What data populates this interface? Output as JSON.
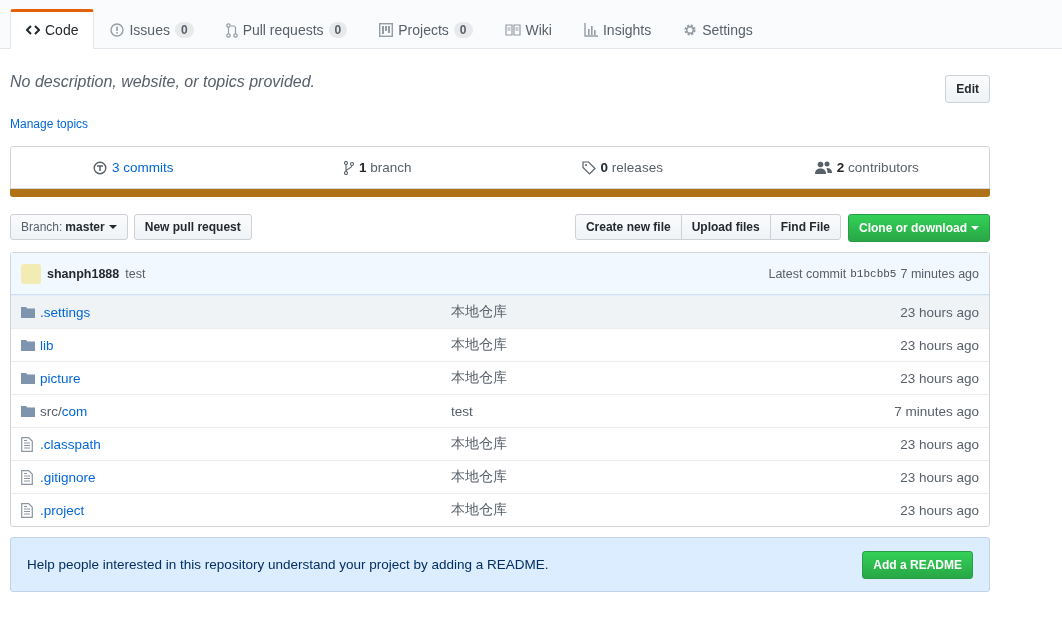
{
  "tabs": [
    {
      "kind": "code",
      "label": "Code",
      "selected": true
    },
    {
      "kind": "issues",
      "label": "Issues",
      "count": "0",
      "selected": false
    },
    {
      "kind": "pulls",
      "label": "Pull requests",
      "count": "0",
      "selected": false
    },
    {
      "kind": "projects",
      "label": "Projects",
      "count": "0",
      "selected": false
    },
    {
      "kind": "wiki",
      "label": "Wiki",
      "selected": false
    },
    {
      "kind": "insights",
      "label": "Insights",
      "selected": false
    },
    {
      "kind": "settings",
      "label": "Settings",
      "selected": false
    }
  ],
  "description": "No description, website, or topics provided.",
  "edit_button": "Edit",
  "manage_topics": "Manage topics",
  "summary": [
    {
      "kind": "commits",
      "number": "3",
      "label": "commits"
    },
    {
      "kind": "branch",
      "number": "1",
      "label": "branch"
    },
    {
      "kind": "releases",
      "number": "0",
      "label": "releases"
    },
    {
      "kind": "contributors",
      "number": "2",
      "label": "contributors"
    }
  ],
  "language_bar": {
    "color": "#b07219"
  },
  "branch_select": {
    "label": "Branch:",
    "value": "master"
  },
  "new_pull_request": "New pull request",
  "file_buttons": [
    "Create new file",
    "Upload files",
    "Find File"
  ],
  "clone_button": "Clone or download",
  "latest_commit": {
    "author": "shanph1888",
    "message": "test",
    "label": "Latest commit",
    "sha": "b1bcbb5",
    "age": "7 minutes ago"
  },
  "files": [
    {
      "kind": "folder",
      "name": ".settings",
      "message": "本地仓库",
      "age": "23 hours ago",
      "highlighted": true
    },
    {
      "kind": "folder",
      "name": "lib",
      "message": "本地仓库",
      "age": "23 hours ago",
      "highlighted": false
    },
    {
      "kind": "folder",
      "name": "picture",
      "message": "本地仓库",
      "age": "23 hours ago",
      "highlighted": false
    },
    {
      "kind": "folder",
      "prefix": "src/",
      "name": "com",
      "message": "test",
      "age": "7 minutes ago",
      "highlighted": false
    },
    {
      "kind": "file",
      "name": ".classpath",
      "message": "本地仓库",
      "age": "23 hours ago",
      "highlighted": false
    },
    {
      "kind": "file",
      "name": ".gitignore",
      "message": "本地仓库",
      "age": "23 hours ago",
      "highlighted": false
    },
    {
      "kind": "file",
      "name": ".project",
      "message": "本地仓库",
      "age": "23 hours ago",
      "highlighted": false
    }
  ],
  "readme_notice": {
    "text": "Help people interested in this repository understand your project by adding a README.",
    "button": "Add a README"
  }
}
